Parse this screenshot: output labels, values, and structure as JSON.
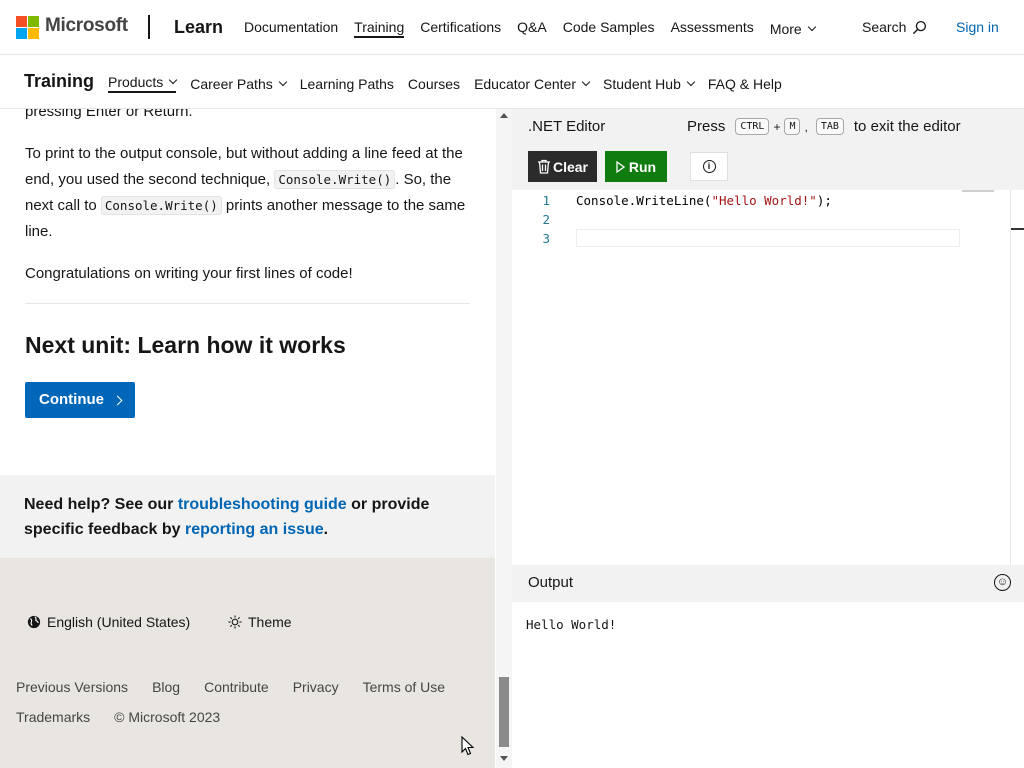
{
  "header": {
    "brand": "Microsoft",
    "site": "Learn",
    "nav": [
      {
        "label": "Documentation"
      },
      {
        "label": "Training",
        "active": true
      },
      {
        "label": "Certifications"
      },
      {
        "label": "Q&A"
      },
      {
        "label": "Code Samples"
      },
      {
        "label": "Assessments"
      },
      {
        "label": "More"
      }
    ],
    "search_label": "Search",
    "sign_in": "Sign in"
  },
  "subnav": {
    "title": "Training",
    "items": [
      {
        "label": "Products"
      },
      {
        "label": "Career Paths"
      },
      {
        "label": "Learning Paths"
      },
      {
        "label": "Courses"
      },
      {
        "label": "Educator Center"
      },
      {
        "label": "Student Hub"
      },
      {
        "label": "FAQ & Help"
      }
    ]
  },
  "article": {
    "partial_line": "pressing Enter or Return.",
    "p2_a": "To print to the output console, but without adding a line feed at the end, you used the second technique, ",
    "p2_code1": "Console.Write()",
    "p2_b": ". So, the next call to ",
    "p2_code2": "Console.Write()",
    "p2_c": " prints another message to the same line.",
    "p3": "Congratulations on writing your first lines of code!",
    "next_unit": "Next unit: Learn how it works",
    "continue": "Continue"
  },
  "help": {
    "prefix": "Need help? See our ",
    "link1": "troubleshooting guide",
    "middle": " or provide specific feedback by ",
    "link2": "reporting an issue",
    "suffix": "."
  },
  "footer": {
    "language": "English (United States)",
    "theme": "Theme",
    "links": [
      "Previous Versions",
      "Blog",
      "Contribute",
      "Privacy",
      "Terms of Use",
      "Trademarks",
      "© Microsoft 2023"
    ]
  },
  "editor": {
    "title": ".NET Editor",
    "hint_press": "Press",
    "key_ctrl": "CTRL",
    "plus": "+",
    "key_m": "M",
    "comma": ",",
    "key_tab": "TAB",
    "hint_exit": "to exit the editor",
    "clear": "Clear",
    "run": "Run",
    "lines": [
      {
        "num": "1",
        "pre": "Console.WriteLine(",
        "str": "\"Hello World!\"",
        "post": ");"
      },
      {
        "num": "2",
        "pre": "",
        "str": "",
        "post": ""
      },
      {
        "num": "3",
        "pre": "",
        "str": "",
        "post": ""
      }
    ],
    "output_title": "Output",
    "output_text": "Hello World!"
  },
  "colors": {
    "continue_bg": "#0067b8",
    "run_bg": "#107c10",
    "clear_bg": "#2b2b2b",
    "link": "#0065b3"
  }
}
